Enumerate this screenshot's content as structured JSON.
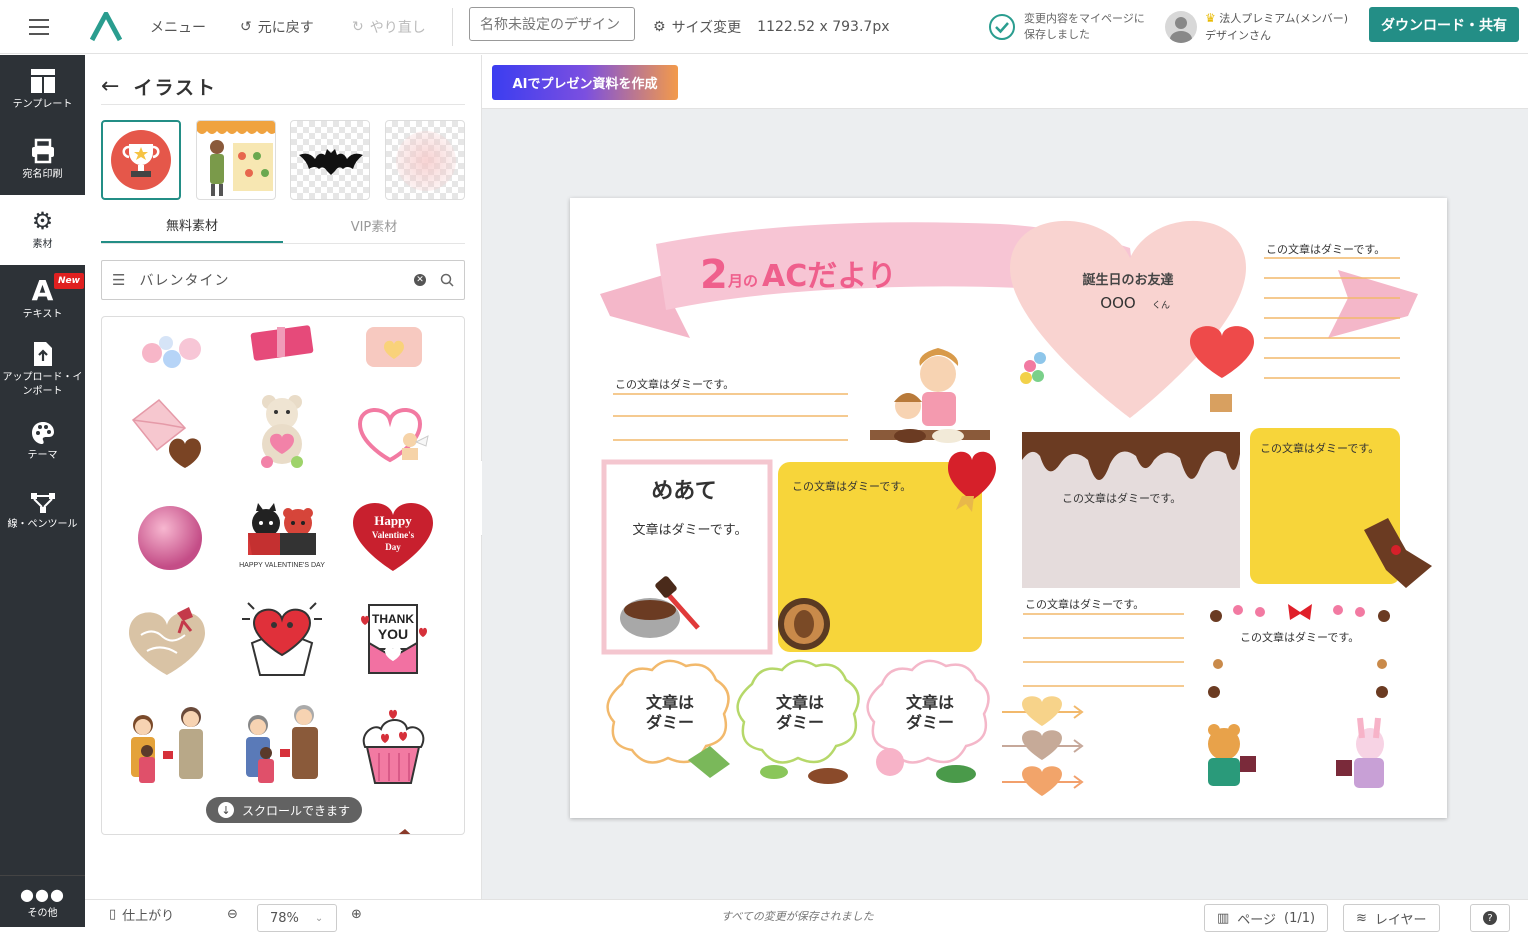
{
  "topbar": {
    "menu_label": "メニュー",
    "undo_label": "元に戻す",
    "redo_label": "やり直し",
    "design_name_placeholder": "名称未設定のデザイン",
    "resize_label": "サイズ変更",
    "size_value": "1122.52 x 793.7px",
    "saved_line1": "変更内容をマイページに",
    "saved_line2": "保存しました",
    "plan_label": "法人プレミアム(メンバー)",
    "user_name": "デザインさん",
    "download_label": "ダウンロード・共有"
  },
  "leftnav": {
    "items": [
      {
        "label": "テンプレート",
        "icon": "template-icon"
      },
      {
        "label": "宛名印刷",
        "icon": "printer-icon"
      },
      {
        "label": "素材",
        "icon": "gear-icon"
      },
      {
        "label": "テキスト",
        "icon": "text-icon"
      },
      {
        "label": "アップロード・インポート",
        "icon": "upload-icon"
      },
      {
        "label": "テーマ",
        "icon": "palette-icon"
      },
      {
        "label": "線・ペンツール",
        "icon": "pen-icon"
      }
    ],
    "new_badge": "New",
    "other_label": "その他"
  },
  "panel": {
    "title": "イラスト",
    "tabs": [
      "無料素材",
      "VIP素材"
    ],
    "search_value": "バレンタイン",
    "scroll_hint": "スクロールできます"
  },
  "canvas": {
    "ai_button": "AIでプレゼン資料を作成",
    "banner_num": "2",
    "banner_small": "月の",
    "banner_rest": "ACだより",
    "birthday_title": "誕生日のお友達",
    "birthday_name": "OOO",
    "birthday_suffix": "くん",
    "dummy": "この文章はダミーです。",
    "meate_title": "めあて",
    "meate_body": "文章はダミーです。",
    "cloud_line1": "文章は",
    "cloud_line2": "ダミー",
    "happy_label": "HAPPY VALENTINE'S DAY",
    "heart_line1": "Happy",
    "heart_line2": "Valentine's",
    "heart_line3": "Day",
    "thank": "THANK",
    "you": "YOU"
  },
  "bottombar": {
    "finish_label": "仕上がり",
    "zoom_value": "78%",
    "status": "すべての変更が保存されました",
    "page_label": "ページ",
    "page_count": "(1/1)",
    "layer_label": "レイヤー",
    "help": "?"
  },
  "colors": {
    "accent": "#238e86",
    "nav_bg": "#2d3237",
    "pink": "#f4a6bf",
    "yellow": "#f7d53a",
    "chocolate": "#6b3b22"
  }
}
